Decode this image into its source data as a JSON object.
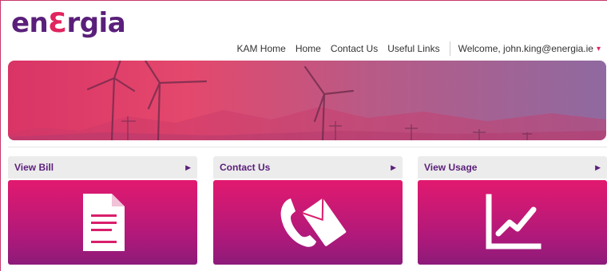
{
  "logo": {
    "prefix": "en",
    "accent": "Ɛ",
    "suffix": "rgia"
  },
  "nav": {
    "items": [
      "KAM Home",
      "Home",
      "Contact Us",
      "Useful Links"
    ],
    "welcome": "Welcome, john.king@energia.ie",
    "caret": "▾"
  },
  "tiles": [
    {
      "label": "View Bill",
      "arrow": "▶",
      "icon": "document-icon"
    },
    {
      "label": "Contact Us",
      "arrow": "▶",
      "icon": "phone-envelope-icon"
    },
    {
      "label": "View Usage",
      "arrow": "▶",
      "icon": "line-chart-icon"
    }
  ],
  "colors": {
    "brand_purple": "#5a1f7a",
    "brand_pink": "#e0245e",
    "tile_pink": "#e2196f"
  }
}
